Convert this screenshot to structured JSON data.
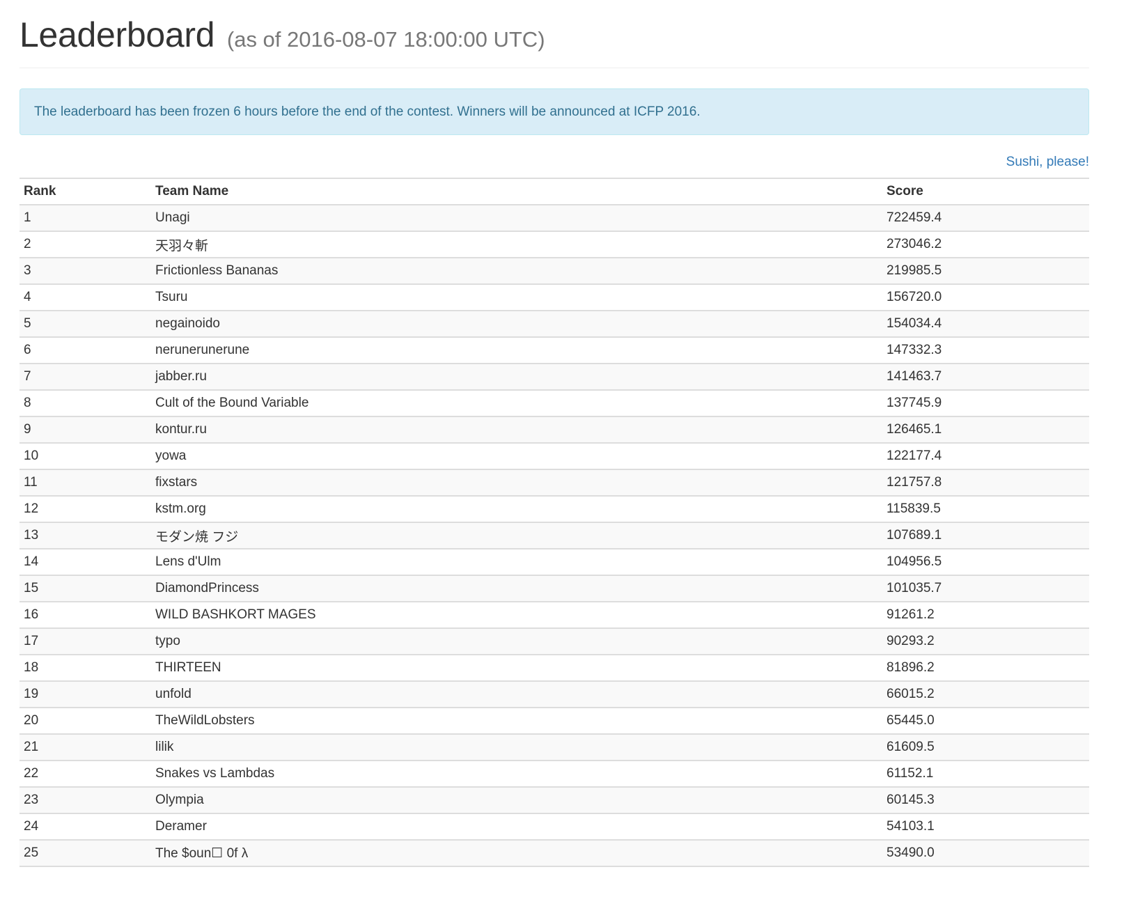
{
  "header": {
    "title": "Leaderboard",
    "subtitle": "(as of 2016-08-07 18:00:00 UTC)"
  },
  "alert": {
    "message": "The leaderboard has been frozen 6 hours before the end of the contest. Winners will be announced at ICFP 2016."
  },
  "sushi_link": "Sushi, please!",
  "table": {
    "columns": [
      "Rank",
      "Team Name",
      "Score"
    ],
    "rows": [
      {
        "rank": "1",
        "team": "Unagi",
        "score": "722459.4"
      },
      {
        "rank": "2",
        "team": "天羽々斬",
        "score": "273046.2"
      },
      {
        "rank": "3",
        "team": "Frictionless Bananas",
        "score": "219985.5"
      },
      {
        "rank": "4",
        "team": "Tsuru",
        "score": "156720.0"
      },
      {
        "rank": "5",
        "team": "negainoido",
        "score": "154034.4"
      },
      {
        "rank": "6",
        "team": "nerunerunerune",
        "score": "147332.3"
      },
      {
        "rank": "7",
        "team": "jabber.ru",
        "score": "141463.7"
      },
      {
        "rank": "8",
        "team": "Cult of the Bound Variable",
        "score": "137745.9"
      },
      {
        "rank": "9",
        "team": "kontur.ru",
        "score": "126465.1"
      },
      {
        "rank": "10",
        "team": "yowa",
        "score": "122177.4"
      },
      {
        "rank": "11",
        "team": "fixstars",
        "score": "121757.8"
      },
      {
        "rank": "12",
        "team": "kstm.org",
        "score": "115839.5"
      },
      {
        "rank": "13",
        "team": "モダン焼 フジ",
        "score": "107689.1"
      },
      {
        "rank": "14",
        "team": "Lens d'Ulm",
        "score": "104956.5"
      },
      {
        "rank": "15",
        "team": "DiamondPrincess",
        "score": "101035.7"
      },
      {
        "rank": "16",
        "team": "WILD BASHKORT MAGES",
        "score": "91261.2"
      },
      {
        "rank": "17",
        "team": "typo",
        "score": "90293.2"
      },
      {
        "rank": "18",
        "team": "THIRTEEN",
        "score": "81896.2"
      },
      {
        "rank": "19",
        "team": "unfold",
        "score": "66015.2"
      },
      {
        "rank": "20",
        "team": "TheWildLobsters",
        "score": "65445.0"
      },
      {
        "rank": "21",
        "team": "lilik",
        "score": "61609.5"
      },
      {
        "rank": "22",
        "team": "Snakes vs Lambdas",
        "score": "61152.1"
      },
      {
        "rank": "23",
        "team": "Olympia",
        "score": "60145.3"
      },
      {
        "rank": "24",
        "team": "Deramer",
        "score": "54103.1"
      },
      {
        "rank": "25",
        "team": "The $oun☐ 0f λ",
        "score": "53490.0"
      }
    ]
  },
  "colors": {
    "alert_bg": "#d9edf7",
    "alert_border": "#bce8f1",
    "alert_text": "#31708f",
    "link": "#337ab7",
    "stripe": "#f9f9f9",
    "rule": "#dddddd"
  }
}
